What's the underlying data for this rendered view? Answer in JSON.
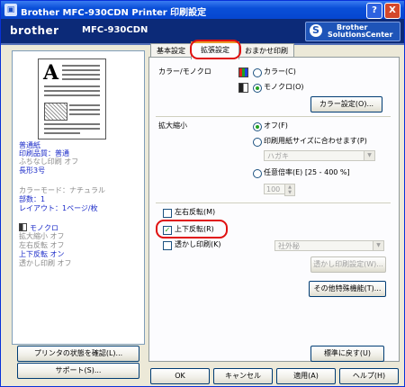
{
  "window": {
    "title": "Brother MFC-930CDN Printer 印刷設定",
    "help_label": "?",
    "close_label": "X"
  },
  "banner": {
    "logo": "brother",
    "model": "MFC-930CDN",
    "solutions_line1": "Brother",
    "solutions_line2": "SolutionsCenter"
  },
  "preview": {
    "big_letter": "A"
  },
  "summary": {
    "paper": "普通紙",
    "quality": "印刷品質：普通",
    "borderless": "ふちなし印刷 オフ",
    "size": "長形3号",
    "color_mode": "カラーモード：ナチュラル",
    "copies": "部数：1",
    "layout": "レイアウト：1ページ/枚",
    "mono": "モノクロ",
    "scaling": "拡大縮小 オフ",
    "mirror": "左右反転 オフ",
    "reverse": "上下反転 オン",
    "watermark": "透かし印刷 オフ"
  },
  "left_buttons": {
    "status": "プリンタの状態を確認(L)...",
    "support": "サポート(S)..."
  },
  "tabs": [
    {
      "label": "基本設定"
    },
    {
      "label": "拡張設定"
    },
    {
      "label": "おまかせ印刷"
    }
  ],
  "color_section": {
    "label": "カラー/モノクロ",
    "color_option": "カラー(C)",
    "mono_option": "モノクロ(O)",
    "selected": "mono",
    "settings_button": "カラー設定(O)..."
  },
  "scaling_section": {
    "label": "拡大縮小",
    "off_option": "オフ(F)",
    "fit_option": "印刷用紙サイズに合わせます(P)",
    "fit_combo_value": "ハガキ",
    "custom_option": "任意倍率(E) [25 - 400 %]",
    "custom_value": "100",
    "selected": "off"
  },
  "options": {
    "mirror": {
      "label": "左右反転(M)",
      "checked": false
    },
    "reverse": {
      "label": "上下反転(R)",
      "checked": true
    },
    "watermark": {
      "label": "透かし印刷(K)",
      "checked": false
    },
    "watermark_combo_value": "社外秘",
    "watermark_settings_button": "透かし印刷設定(W)...",
    "other_features_button": "その他特殊機能(T)..."
  },
  "bottom_buttons": {
    "default": "標準に戻す(U)",
    "ok": "OK",
    "cancel": "キャンセル",
    "apply": "適用(A)",
    "help": "ヘルプ(H)"
  },
  "colors": {
    "banner": "#0c2a78",
    "titlebar": "#0a4fd8",
    "highlight": "#e01010",
    "summary_blue": "#1a2ac8"
  }
}
